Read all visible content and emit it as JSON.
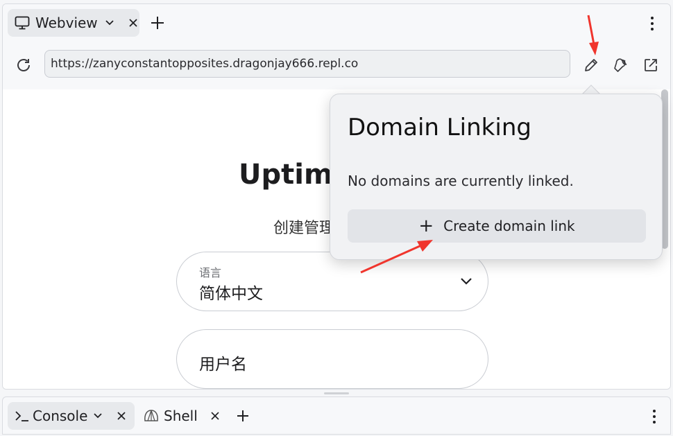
{
  "top_tabs": {
    "active_tab": {
      "label": "Webview",
      "icon": "monitor-icon"
    },
    "add_label": "+"
  },
  "address": {
    "url": "https://zanyconstantopposites.dragonjay666.repl.co"
  },
  "page": {
    "title": "Uptime",
    "subtitle": "创建管理",
    "language_field": {
      "label": "语言",
      "value": "简体中文"
    },
    "username_field": {
      "placeholder": "用户名"
    }
  },
  "popover": {
    "title": "Domain Linking",
    "message": "No domains are currently linked.",
    "create_button": "Create domain link"
  },
  "bottom_tabs": {
    "console": {
      "label": "Console"
    },
    "shell": {
      "label": "Shell"
    }
  },
  "colors": {
    "annotation_arrow": "#f0352d",
    "tab_active_bg": "#e7e9ec",
    "popover_bg": "#f1f2f4"
  }
}
